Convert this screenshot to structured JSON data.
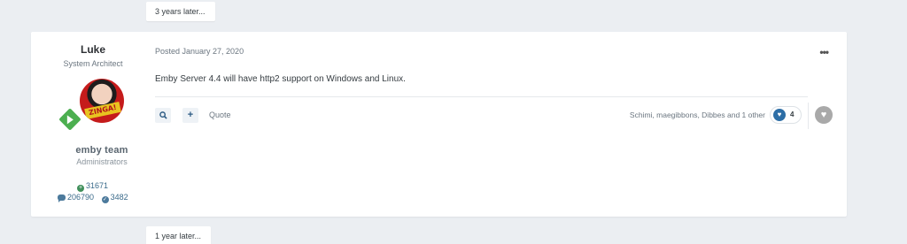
{
  "gaps": {
    "top": "3 years later...",
    "bottom": "1 year later..."
  },
  "author": {
    "name": "Luke",
    "title": "System Architect",
    "avatar_banner": "ZINGA!",
    "group_title": "emby team",
    "group_name": "Administrators",
    "reputation": "31671",
    "posts": "206790",
    "solutions": "3482"
  },
  "post": {
    "date": "Posted January 27, 2020",
    "body": "Emby Server 4.4 will have http2 support on Windows and Linux.",
    "more_label": "•••",
    "quote_label": "Quote",
    "reactors": "Schimi, maegibbons, Dibbes and 1 other",
    "reaction_count": "4"
  },
  "icons": {
    "search": "search-icon",
    "multiquote": "plus-icon",
    "reaction": "heart-icon",
    "react_button": "heart-icon",
    "reputation": "plus-circle-icon",
    "posts": "comment-icon",
    "solutions": "check-circle-icon"
  },
  "colors": {
    "page_bg": "#ebeef2",
    "card_bg": "#ffffff",
    "accent": "#2d6ea6",
    "reputation_green": "#3f8f5a"
  }
}
